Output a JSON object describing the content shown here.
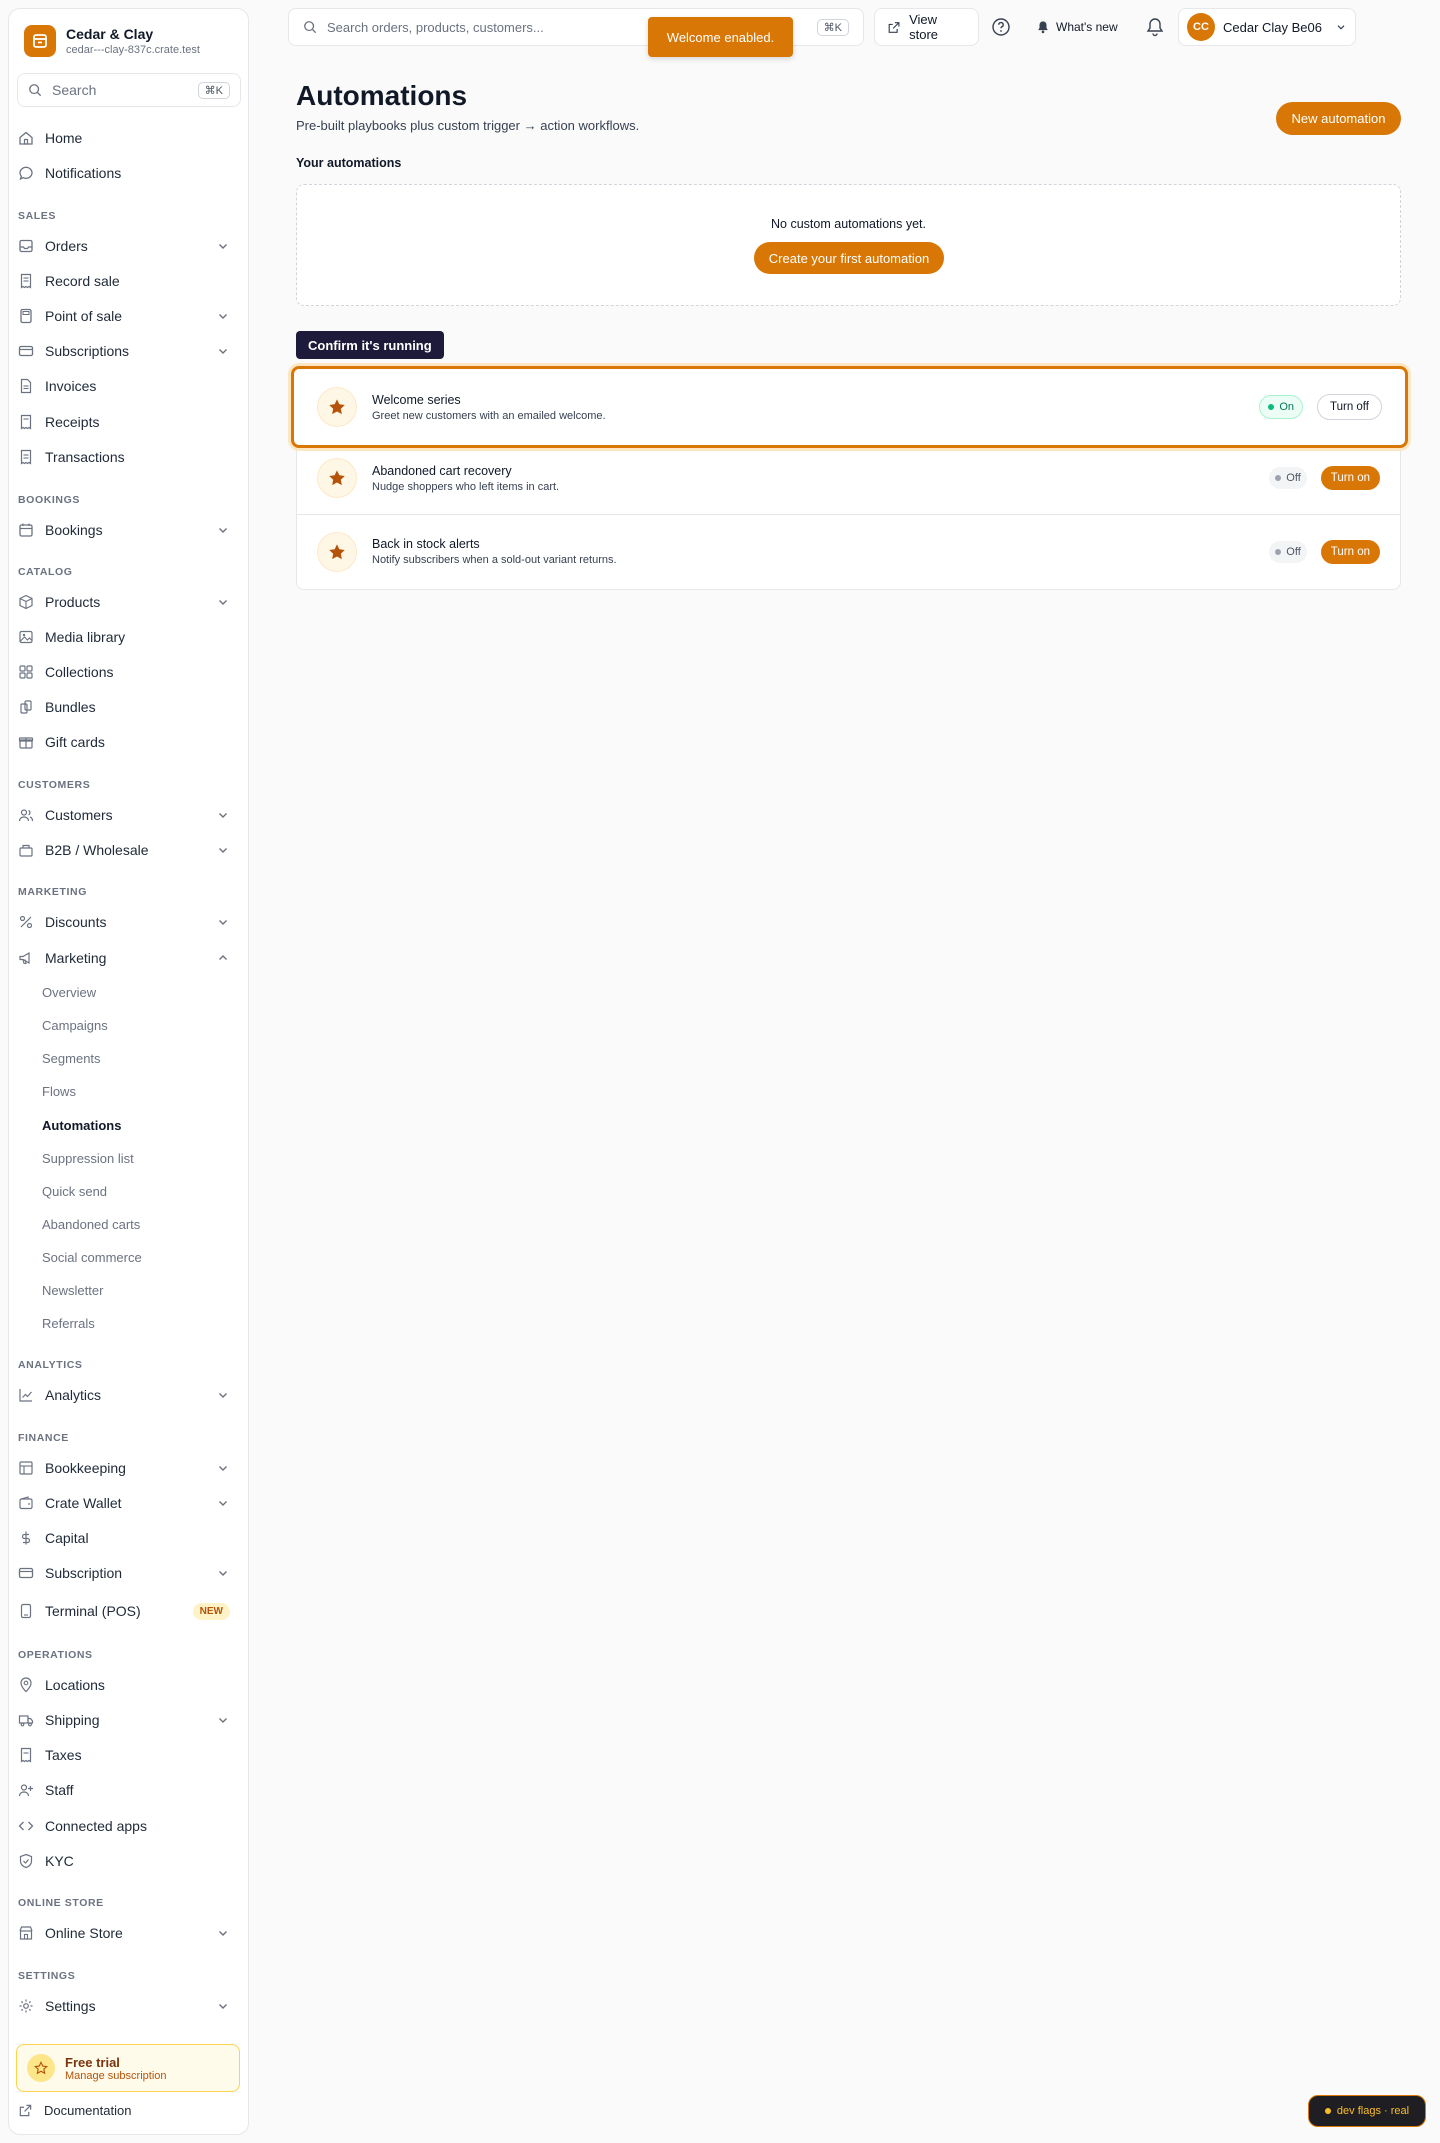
{
  "brand": {
    "name": "Cedar & Clay",
    "domain": "cedar---clay-837c.crate.test"
  },
  "sidebar_search": {
    "placeholder": "Search",
    "shortcut": "⌘K"
  },
  "nav": {
    "home": "Home",
    "notifications": "Notifications",
    "sections": {
      "sales": "SALES",
      "bookings": "BOOKINGS",
      "catalog": "CATALOG",
      "customers": "CUSTOMERS",
      "marketing": "MARKETING",
      "analytics": "ANALYTICS",
      "finance": "FINANCE",
      "operations": "OPERATIONS",
      "online_store": "ONLINE STORE",
      "settings": "SETTINGS"
    },
    "orders": "Orders",
    "record_sale": "Record sale",
    "pos": "Point of sale",
    "subscriptions": "Subscriptions",
    "invoices": "Invoices",
    "receipts": "Receipts",
    "transactions": "Transactions",
    "bookings": "Bookings",
    "products": "Products",
    "media": "Media library",
    "collections": "Collections",
    "bundles": "Bundles",
    "gift_cards": "Gift cards",
    "customers": "Customers",
    "b2b": "B2B / Wholesale",
    "discounts": "Discounts",
    "marketing": "Marketing",
    "marketing_sub": [
      "Overview",
      "Campaigns",
      "Segments",
      "Flows",
      "Automations",
      "Suppression list",
      "Quick send",
      "Abandoned carts",
      "Social commerce",
      "Newsletter",
      "Referrals"
    ],
    "analytics": "Analytics",
    "bookkeeping": "Bookkeeping",
    "wallet": "Crate Wallet",
    "capital": "Capital",
    "subscription": "Subscription",
    "terminal": "Terminal (POS)",
    "new_badge": "NEW",
    "locations": "Locations",
    "shipping": "Shipping",
    "taxes": "Taxes",
    "staff": "Staff",
    "connected_apps": "Connected apps",
    "kyc": "KYC",
    "online_store": "Online Store",
    "settings": "Settings"
  },
  "trial": {
    "title": "Free trial",
    "subtitle": "Manage subscription"
  },
  "docs": "Documentation",
  "topbar": {
    "search_placeholder": "Search orders, products, customers...",
    "search_shortcut": "⌘K",
    "view_store": "View store",
    "whats_new": "What's new",
    "user_initials": "CC",
    "user_name": "Cedar Clay Be06"
  },
  "toast": "Welcome enabled.",
  "page": {
    "title": "Automations",
    "subtitle": "Pre-built playbooks plus custom trigger → action workflows.",
    "new_button": "New automation",
    "your_label": "Your automations",
    "empty_text": "No custom automations yet.",
    "create_first": "Create your first automation",
    "tooltip": "Confirm it's running"
  },
  "automations": [
    {
      "title": "Welcome series",
      "desc": "Greet new customers with an emailed welcome.",
      "status": "On",
      "action": "Turn off"
    },
    {
      "title": "Abandoned cart recovery",
      "desc": "Nudge shoppers who left items in cart.",
      "status": "Off",
      "action": "Turn on"
    },
    {
      "title": "Back in stock alerts",
      "desc": "Notify subscribers when a sold-out variant returns.",
      "status": "Off",
      "action": "Turn on"
    }
  ],
  "devflags": "dev flags · real",
  "colors": {
    "accent": "#d97706",
    "on_green": "#10b981",
    "tooltip_bg": "#1e1b3a"
  }
}
